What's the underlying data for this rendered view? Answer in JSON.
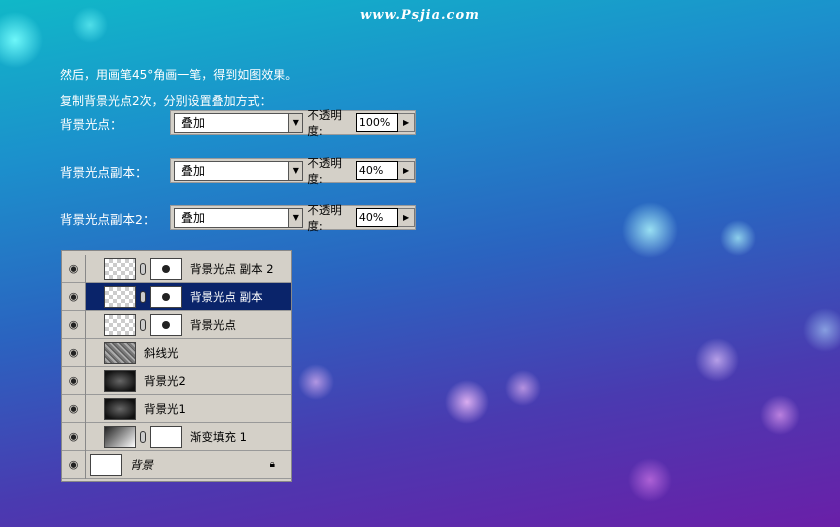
{
  "site": "www.Psjia.com",
  "instructions": [
    "然后，用画笔45°角画一笔，得到如图效果。",
    "复制背景光点2次，分别设置叠加方式："
  ],
  "settings": [
    {
      "label": "背景光点：",
      "blend": "叠加",
      "opacity_label": "不透明度:",
      "opacity": "100%"
    },
    {
      "label": "背景光点副本：",
      "blend": "叠加",
      "opacity_label": "不透明度:",
      "opacity": "40%"
    },
    {
      "label": "背景光点副本2：",
      "blend": "叠加",
      "opacity_label": "不透明度:",
      "opacity": "40%"
    }
  ],
  "layers": [
    {
      "name": "背景光点 副本 2",
      "thumb": "transparent",
      "mask": "dot"
    },
    {
      "name": "背景光点 副本",
      "thumb": "transparent",
      "mask": "dot",
      "selected": true
    },
    {
      "name": "背景光点",
      "thumb": "transparent",
      "mask": "dot"
    },
    {
      "name": "斜线光",
      "thumb": "noise"
    },
    {
      "name": "背景光2",
      "thumb": "dark"
    },
    {
      "name": "背景光1",
      "thumb": "dark"
    },
    {
      "name": "渐变填充 1",
      "thumb": "gradient",
      "mask": "white"
    },
    {
      "name": "背景",
      "thumb": "white",
      "locked": true
    }
  ]
}
